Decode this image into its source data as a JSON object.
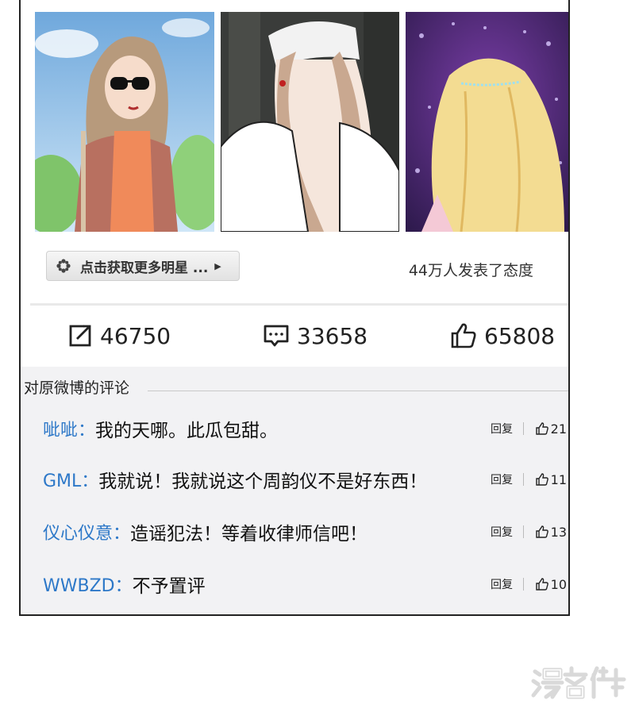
{
  "more_stars_button": {
    "label": "点击获取更多明星 ...",
    "icon": "flower-icon"
  },
  "attitude_text": "44万人发表了态度",
  "stats": {
    "repost": {
      "icon": "share-icon",
      "count": "46750"
    },
    "comment": {
      "icon": "comment-icon",
      "count": "33658"
    },
    "like": {
      "icon": "thumbs-up-icon",
      "count": "65808"
    }
  },
  "comments_section": {
    "header": "对原微博的评论",
    "items": [
      {
        "user": "呲呲：",
        "text": "我的天哪。此瓜包甜。",
        "reply": "回复",
        "likes": "21"
      },
      {
        "user": "GML：",
        "text": "我就说！我就说这个周韵仪不是好东西！",
        "reply": "回复",
        "likes": "11"
      },
      {
        "user": "仪心仪意：",
        "text": "造谣犯法！等着收律师信吧！",
        "reply": "回复",
        "likes": "13"
      },
      {
        "user": "WWBZD：",
        "text": "不予置评",
        "reply": "回复",
        "likes": "10"
      }
    ]
  },
  "watermark": "漫客栈",
  "colors": {
    "username": "#2d78c8",
    "panel_bg": "#f2f2f4",
    "frame": "#222222"
  }
}
